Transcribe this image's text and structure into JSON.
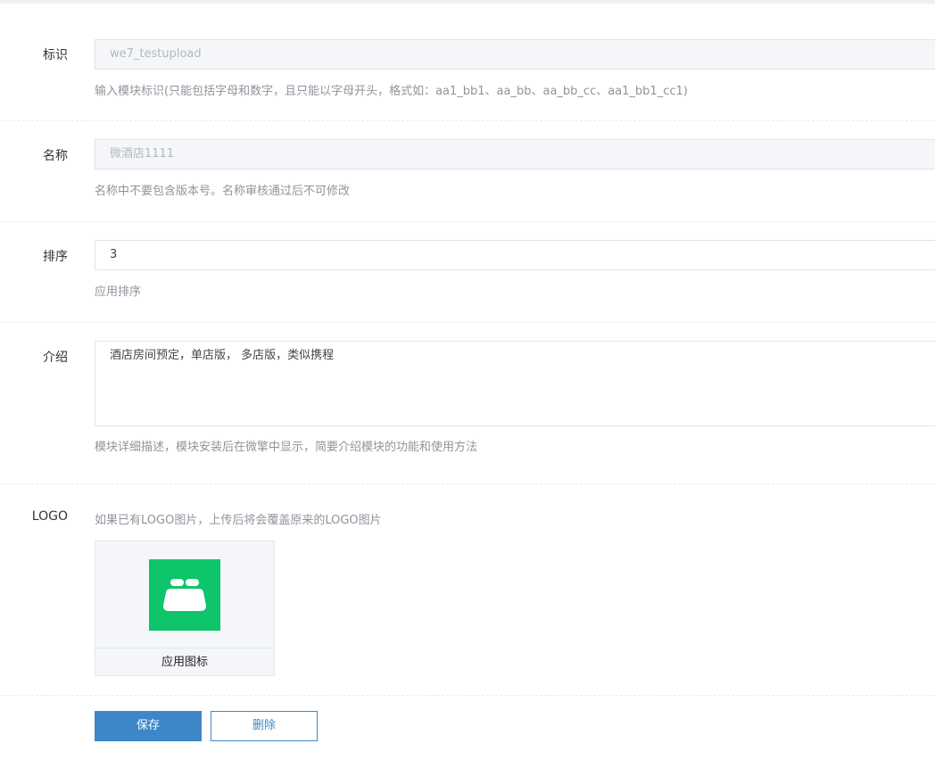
{
  "fields": {
    "identifier": {
      "label": "标识",
      "value": "we7_testupload",
      "help": "输入模块标识(只能包括字母和数字，且只能以字母开头，格式如：aa1_bb1、aa_bb、aa_bb_cc、aa1_bb1_cc1)"
    },
    "name": {
      "label": "名称",
      "value": "微酒店1111",
      "help": "名称中不要包含版本号。名称审核通过后不可修改"
    },
    "order": {
      "label": "排序",
      "value": "3",
      "help": "应用排序"
    },
    "intro": {
      "label": "介绍",
      "value": "酒店房间预定，单店版， 多店版，类似携程",
      "help": "模块详细描述，模块安装后在微擎中显示，简要介绍模块的功能和使用方法"
    },
    "logo": {
      "label": "LOGO",
      "help": "如果已有LOGO图片，上传后将会覆盖原来的LOGO图片",
      "caption": "应用图标",
      "icon": "bed-icon",
      "icon_bg": "#0fc56b"
    }
  },
  "actions": {
    "save_label": "保存",
    "delete_label": "删除",
    "primary_color": "#3d87c9"
  }
}
